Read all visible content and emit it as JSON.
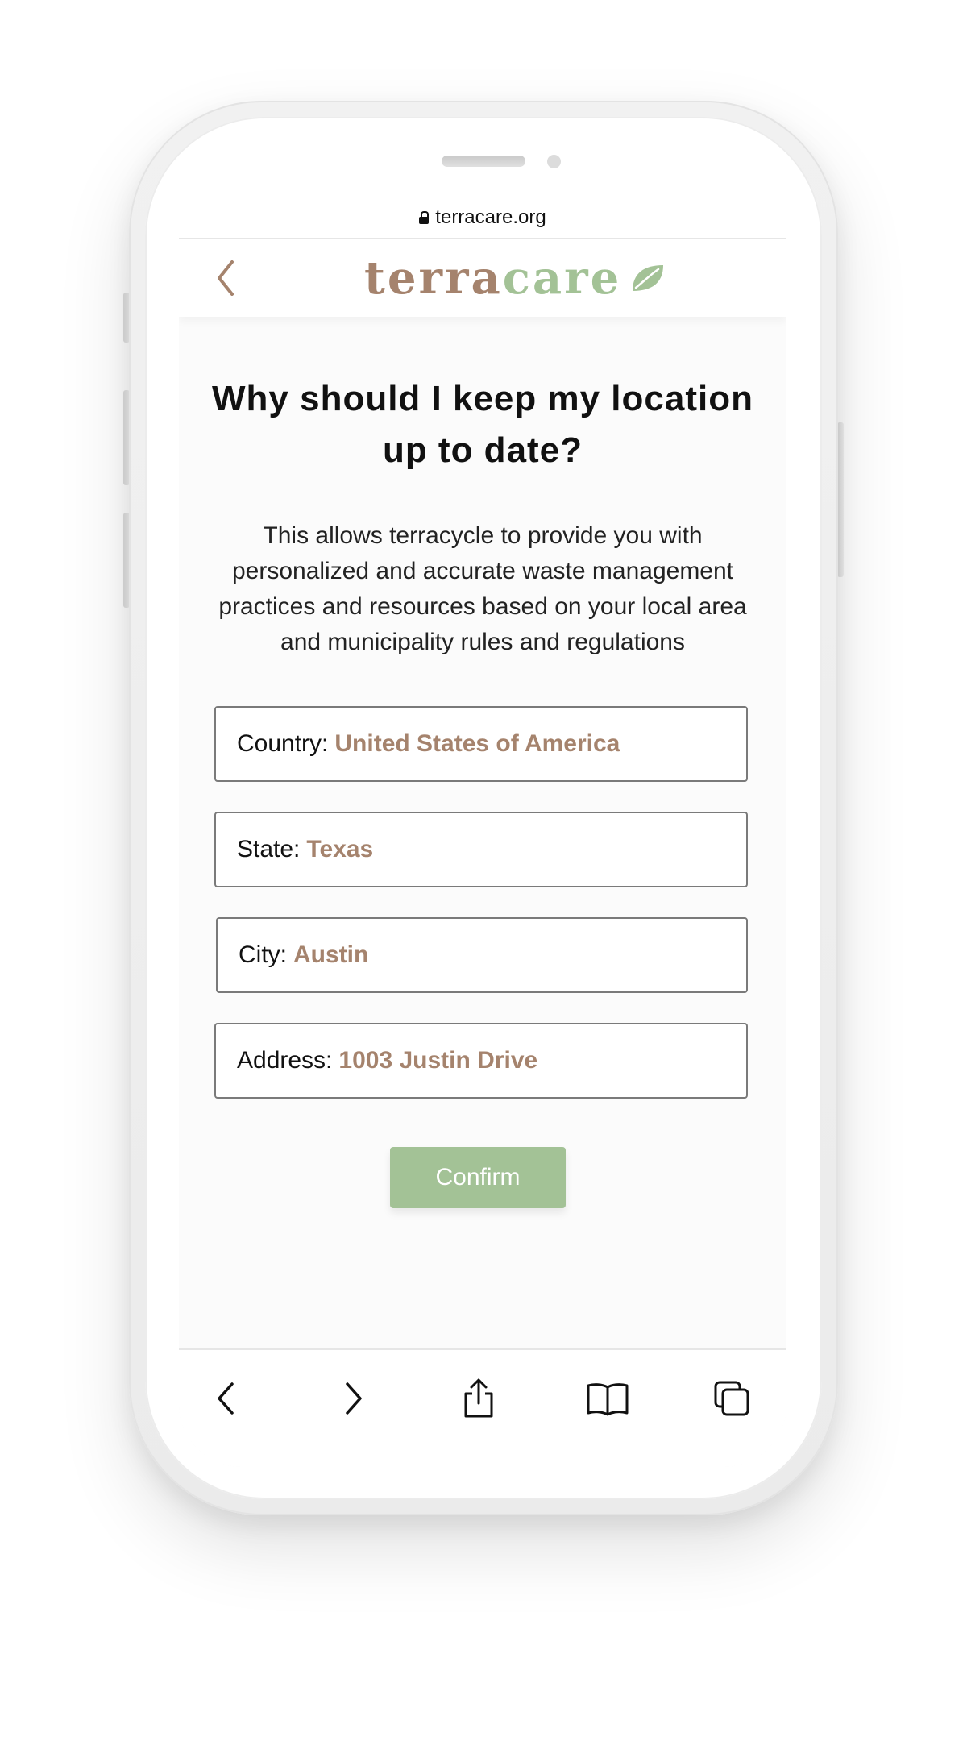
{
  "browser": {
    "url": "terracare.org"
  },
  "header": {
    "logo_terra": "terra",
    "logo_care": "care",
    "accent_brown": "#a5836d",
    "accent_green": "#a3c296"
  },
  "main": {
    "heading": "Why should I keep my location up to date?",
    "description": "This allows terracycle to provide you with personalized and accurate waste management practices and resources based on your local area and municipality rules and regulations",
    "fields": [
      {
        "label": "Country:",
        "value": "United States of America"
      },
      {
        "label": "State:",
        "value": "Texas"
      },
      {
        "label": "City:",
        "value": "Austin"
      },
      {
        "label": "Address:",
        "value": "1003 Justin Drive"
      }
    ],
    "confirm_label": "Confirm"
  },
  "toolbar": {
    "icons": [
      "back-icon",
      "forward-icon",
      "share-icon",
      "bookmarks-icon",
      "tabs-icon"
    ]
  }
}
